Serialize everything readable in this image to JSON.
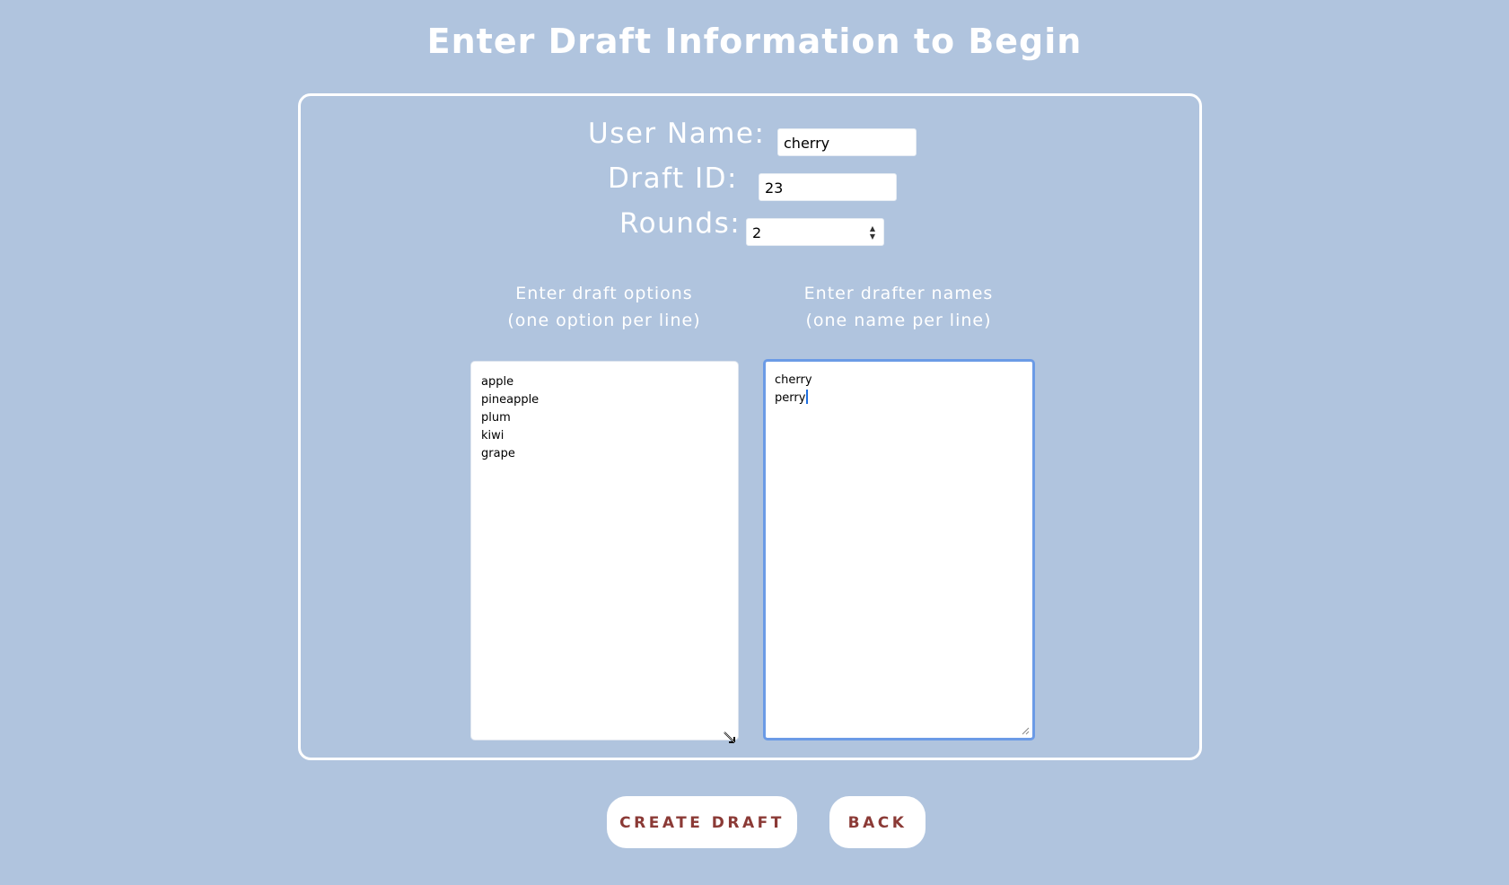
{
  "page": {
    "title": "Enter Draft Information to Begin"
  },
  "form": {
    "user_name": {
      "label": "User Name:",
      "value": "cherry"
    },
    "draft_id": {
      "label": "Draft ID:",
      "value": "23"
    },
    "rounds": {
      "label": "Rounds:",
      "value": "2"
    },
    "draft_options": {
      "caption_line1": "Enter draft options",
      "caption_line2": "(one option per line)",
      "lines": [
        "apple",
        "pineapple",
        "plum",
        "kiwi",
        "grape"
      ]
    },
    "drafter_names": {
      "caption_line1": "Enter drafter names",
      "caption_line2": "(one name per line)",
      "lines": [
        "cherry",
        "perry"
      ]
    }
  },
  "buttons": {
    "create_draft": "CREATE DRAFT",
    "back": "BACK"
  },
  "colors": {
    "background": "#b0c4de",
    "button_text": "#8b3a36",
    "focus_border": "#6b9be6"
  }
}
